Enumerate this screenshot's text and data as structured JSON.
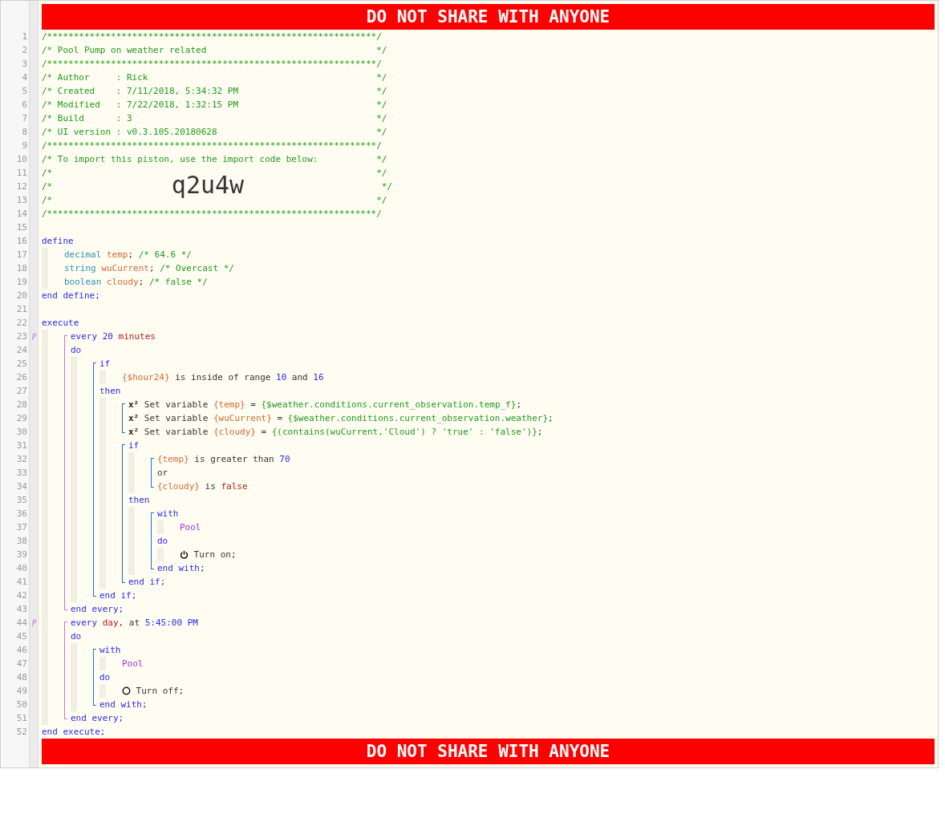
{
  "header_banner": "DO NOT SHARE WITH ANYONE",
  "code": [
    {
      "kind": "line",
      "number": "1",
      "marked": false,
      "tokens": [
        {
          "kind": "comment",
          "text": "/**************************************************************/"
        }
      ]
    },
    {
      "kind": "line",
      "number": "2",
      "marked": false,
      "tokens": [
        {
          "kind": "commentpad",
          "text": "/* Pool Pump on weather related"
        },
        {
          "kind": "comment",
          "text": "*/"
        }
      ]
    },
    {
      "kind": "line",
      "number": "3",
      "marked": false,
      "tokens": [
        {
          "kind": "comment",
          "text": "/**************************************************************/"
        }
      ]
    },
    {
      "kind": "line",
      "number": "4",
      "marked": false,
      "tokens": [
        {
          "kind": "commentpad",
          "text": "/* Author     : Rick"
        },
        {
          "kind": "comment",
          "text": "*/"
        }
      ]
    },
    {
      "kind": "line",
      "number": "5",
      "marked": false,
      "tokens": [
        {
          "kind": "commentpad",
          "text": "/* Created    : 7/11/2018, 5:34:32 PM"
        },
        {
          "kind": "comment",
          "text": "*/"
        }
      ]
    },
    {
      "kind": "line",
      "number": "6",
      "marked": false,
      "tokens": [
        {
          "kind": "commentpad",
          "text": "/* Modified   : 7/22/2018, 1:32:15 PM"
        },
        {
          "kind": "comment",
          "text": "*/"
        }
      ]
    },
    {
      "kind": "line",
      "number": "7",
      "marked": false,
      "tokens": [
        {
          "kind": "commentpad",
          "text": "/* Build      : 3"
        },
        {
          "kind": "comment",
          "text": "*/"
        }
      ]
    },
    {
      "kind": "line",
      "number": "8",
      "marked": false,
      "tokens": [
        {
          "kind": "commentpad",
          "text": "/* UI version : v0.3.105.20180628"
        },
        {
          "kind": "comment",
          "text": "*/"
        }
      ]
    },
    {
      "kind": "line",
      "number": "9",
      "marked": false,
      "tokens": [
        {
          "kind": "comment",
          "text": "/**************************************************************/"
        }
      ]
    },
    {
      "kind": "line",
      "number": "10",
      "marked": false,
      "tokens": [
        {
          "kind": "commentpad",
          "text": "/* To import this piston, use the import code below:"
        },
        {
          "kind": "comment",
          "text": "*/"
        }
      ]
    },
    {
      "kind": "line",
      "number": "11",
      "marked": false,
      "tokens": [
        {
          "kind": "commentpad",
          "text": "/*"
        },
        {
          "kind": "comment",
          "text": "*/"
        }
      ]
    },
    {
      "kind": "line",
      "number": "12",
      "marked": false,
      "tokens": [
        {
          "kind": "comment",
          "text": "/*"
        },
        {
          "kind": "code",
          "text": "q2u4w"
        },
        {
          "kind": "comment",
          "text": "*/"
        }
      ]
    },
    {
      "kind": "line",
      "number": "13",
      "marked": false,
      "tokens": [
        {
          "kind": "commentpad",
          "text": "/*"
        },
        {
          "kind": "comment",
          "text": "*/"
        }
      ]
    },
    {
      "kind": "line",
      "number": "14",
      "marked": false,
      "tokens": [
        {
          "kind": "comment",
          "text": "/**************************************************************/"
        }
      ]
    },
    {
      "kind": "line",
      "number": "15",
      "marked": false
    },
    {
      "kind": "line",
      "number": "16",
      "marked": false,
      "tokens": [
        {
          "kind": "keyword",
          "text": "define"
        }
      ]
    },
    {
      "kind": "body",
      "children": [
        {
          "kind": "line",
          "number": "17",
          "marked": false,
          "tokens": [
            {
              "kind": "type",
              "text": "decimal"
            },
            {
              "kind": "variable",
              "text": "temp"
            },
            {
              "kind": "glued",
              "text": ";"
            },
            {
              "kind": "comment",
              "text": "/* 64.6 */"
            }
          ]
        },
        {
          "kind": "line",
          "number": "18",
          "marked": false,
          "tokens": [
            {
              "kind": "type",
              "text": "string"
            },
            {
              "kind": "variable",
              "text": "wuCurrent"
            },
            {
              "kind": "glued",
              "text": ";"
            },
            {
              "kind": "comment",
              "text": "/* Overcast */"
            }
          ]
        },
        {
          "kind": "line",
          "number": "19",
          "marked": false,
          "tokens": [
            {
              "kind": "type",
              "text": "boolean"
            },
            {
              "kind": "variable",
              "text": "cloudy"
            },
            {
              "kind": "glued",
              "text": ";"
            },
            {
              "kind": "comment",
              "text": "/* false */"
            }
          ]
        }
      ]
    },
    {
      "kind": "line",
      "number": "20",
      "marked": false,
      "tokens": [
        {
          "kind": "keyword",
          "text": "end define;"
        }
      ]
    },
    {
      "kind": "line",
      "number": "21",
      "marked": false
    },
    {
      "kind": "line",
      "number": "22",
      "marked": false,
      "tokens": [
        {
          "kind": "keyword",
          "text": "execute"
        }
      ]
    },
    {
      "kind": "body",
      "children": [
        {
          "kind": "group",
          "color": "#d070d8",
          "children": [
            {
              "kind": "line",
              "number": "23",
              "marked": true,
              "tokens": [
                {
                  "kind": "keyword",
                  "text": "every"
                },
                {
                  "kind": "number",
                  "text": "20"
                },
                {
                  "kind": "unit",
                  "text": "minutes"
                }
              ]
            },
            {
              "kind": "line",
              "number": "24",
              "marked": false,
              "tokens": [
                {
                  "kind": "keyword",
                  "text": "do"
                }
              ]
            },
            {
              "kind": "body",
              "children": [
                {
                  "kind": "group",
                  "color": "#1a6fd8",
                  "children": [
                    {
                      "kind": "line",
                      "number": "25",
                      "marked": false,
                      "tokens": [
                        {
                          "kind": "keyword",
                          "text": "if"
                        }
                      ]
                    },
                    {
                      "kind": "body",
                      "children": [
                        {
                          "kind": "line",
                          "number": "26",
                          "marked": false,
                          "tokens": [
                            {
                              "kind": "variable",
                              "text": "{$hour24}"
                            },
                            {
                              "kind": "text",
                              "text": "is inside of range"
                            },
                            {
                              "kind": "number",
                              "text": "10"
                            },
                            {
                              "kind": "text",
                              "text": "and"
                            },
                            {
                              "kind": "number",
                              "text": "16"
                            }
                          ]
                        }
                      ]
                    },
                    {
                      "kind": "line",
                      "number": "27",
                      "marked": false,
                      "tokens": [
                        {
                          "kind": "keyword",
                          "text": "then"
                        }
                      ]
                    },
                    {
                      "kind": "body",
                      "children": [
                        {
                          "kind": "group",
                          "color": "#1a6fd8",
                          "children": [
                            {
                              "kind": "line",
                              "number": "28",
                              "marked": false,
                              "tokens": [
                                {
                                  "kind": "op",
                                  "text": "x²"
                                },
                                {
                                  "kind": "text",
                                  "text": "Set variable"
                                },
                                {
                                  "kind": "variable",
                                  "text": "{temp}"
                                },
                                {
                                  "kind": "text",
                                  "text": "="
                                },
                                {
                                  "kind": "expression",
                                  "text": "{$weather.conditions.current_observation.temp_f}"
                                },
                                {
                                  "kind": "glued",
                                  "text": ";"
                                }
                              ]
                            },
                            {
                              "kind": "line",
                              "number": "29",
                              "marked": false,
                              "tokens": [
                                {
                                  "kind": "op",
                                  "text": "x²"
                                },
                                {
                                  "kind": "text",
                                  "text": "Set variable"
                                },
                                {
                                  "kind": "variable",
                                  "text": "{wuCurrent}"
                                },
                                {
                                  "kind": "text",
                                  "text": "="
                                },
                                {
                                  "kind": "expression",
                                  "text": "{$weather.conditions.current_observation.weather}"
                                },
                                {
                                  "kind": "glued",
                                  "text": ";"
                                }
                              ]
                            },
                            {
                              "kind": "line",
                              "number": "30",
                              "marked": false,
                              "tokens": [
                                {
                                  "kind": "op",
                                  "text": "x²"
                                },
                                {
                                  "kind": "text",
                                  "text": "Set variable"
                                },
                                {
                                  "kind": "variable",
                                  "text": "{cloudy}"
                                },
                                {
                                  "kind": "text",
                                  "text": "="
                                },
                                {
                                  "kind": "expression",
                                  "text": "{(contains(wuCurrent,'Cloud') ? 'true' : 'false')}"
                                },
                                {
                                  "kind": "glued",
                                  "text": ";"
                                }
                              ]
                            }
                          ]
                        },
                        {
                          "kind": "group",
                          "color": "#1a6fd8",
                          "children": [
                            {
                              "kind": "line",
                              "number": "31",
                              "marked": false,
                              "tokens": [
                                {
                                  "kind": "keyword",
                                  "text": "if"
                                }
                              ]
                            },
                            {
                              "kind": "body",
                              "children": [
                                {
                                  "kind": "group",
                                  "color": "#1a6fd8",
                                  "children": [
                                    {
                                      "kind": "line",
                                      "number": "32",
                                      "marked": false,
                                      "tokens": [
                                        {
                                          "kind": "variable",
                                          "text": "{temp}"
                                        },
                                        {
                                          "kind": "text",
                                          "text": "is greater than"
                                        },
                                        {
                                          "kind": "number",
                                          "text": "70"
                                        }
                                      ]
                                    },
                                    {
                                      "kind": "line",
                                      "number": "33",
                                      "marked": false,
                                      "tokens": [
                                        {
                                          "kind": "text",
                                          "text": "or"
                                        }
                                      ]
                                    },
                                    {
                                      "kind": "line",
                                      "number": "34",
                                      "marked": false,
                                      "tokens": [
                                        {
                                          "kind": "variable",
                                          "text": "{cloudy}"
                                        },
                                        {
                                          "kind": "text",
                                          "text": "is"
                                        },
                                        {
                                          "kind": "unit",
                                          "text": "false"
                                        }
                                      ]
                                    }
                                  ]
                                }
                              ]
                            },
                            {
                              "kind": "line",
                              "number": "35",
                              "marked": false,
                              "tokens": [
                                {
                                  "kind": "keyword",
                                  "text": "then"
                                }
                              ]
                            },
                            {
                              "kind": "body",
                              "children": [
                                {
                                  "kind": "group",
                                  "color": "#1a6fd8",
                                  "children": [
                                    {
                                      "kind": "line",
                                      "number": "36",
                                      "marked": false,
                                      "tokens": [
                                        {
                                          "kind": "keyword",
                                          "text": "with"
                                        }
                                      ]
                                    },
                                    {
                                      "kind": "body",
                                      "children": [
                                        {
                                          "kind": "line",
                                          "number": "37",
                                          "marked": false,
                                          "tokens": [
                                            {
                                              "kind": "device",
                                              "text": "Pool"
                                            }
                                          ]
                                        }
                                      ]
                                    },
                                    {
                                      "kind": "line",
                                      "number": "38",
                                      "marked": false,
                                      "tokens": [
                                        {
                                          "kind": "keyword",
                                          "text": "do"
                                        }
                                      ]
                                    },
                                    {
                                      "kind": "body",
                                      "children": [
                                        {
                                          "kind": "line",
                                          "number": "39",
                                          "marked": false,
                                          "tokens": [
                                            {
                                              "kind": "switch",
                                              "on": true
                                            },
                                            {
                                              "kind": "text",
                                              "text": "Turn on;"
                                            }
                                          ]
                                        }
                                      ]
                                    },
                                    {
                                      "kind": "line",
                                      "number": "40",
                                      "marked": false,
                                      "tokens": [
                                        {
                                          "kind": "keyword",
                                          "text": "end with;"
                                        }
                                      ]
                                    }
                                  ]
                                }
                              ]
                            },
                            {
                              "kind": "line",
                              "number": "41",
                              "marked": false,
                              "tokens": [
                                {
                                  "kind": "keyword",
                                  "text": "end if;"
                                }
                              ]
                            }
                          ]
                        }
                      ]
                    },
                    {
                      "kind": "line",
                      "number": "42",
                      "marked": false,
                      "tokens": [
                        {
                          "kind": "keyword",
                          "text": "end if;"
                        }
                      ]
                    }
                  ]
                }
              ]
            },
            {
              "kind": "line",
              "number": "43",
              "marked": false,
              "tokens": [
                {
                  "kind": "keyword",
                  "text": "end every;"
                }
              ]
            }
          ]
        },
        {
          "kind": "group",
          "color": "#d070d8",
          "children": [
            {
              "kind": "line",
              "number": "44",
              "marked": true,
              "tokens": [
                {
                  "kind": "keyword",
                  "text": "every"
                },
                {
                  "kind": "unit",
                  "text": "day,"
                },
                {
                  "kind": "text",
                  "text": "at"
                },
                {
                  "kind": "number",
                  "text": "5:45:00 PM"
                }
              ]
            },
            {
              "kind": "line",
              "number": "45",
              "marked": false,
              "tokens": [
                {
                  "kind": "keyword",
                  "text": "do"
                }
              ]
            },
            {
              "kind": "body",
              "children": [
                {
                  "kind": "group",
                  "color": "#1a6fd8",
                  "children": [
                    {
                      "kind": "line",
                      "number": "46",
                      "marked": false,
                      "tokens": [
                        {
                          "kind": "keyword",
                          "text": "with"
                        }
                      ]
                    },
                    {
                      "kind": "body",
                      "children": [
                        {
                          "kind": "line",
                          "number": "47",
                          "marked": false,
                          "tokens": [
                            {
                              "kind": "device",
                              "text": "Pool"
                            }
                          ]
                        }
                      ]
                    },
                    {
                      "kind": "line",
                      "number": "48",
                      "marked": false,
                      "tokens": [
                        {
                          "kind": "keyword",
                          "text": "do"
                        }
                      ]
                    },
                    {
                      "kind": "body",
                      "children": [
                        {
                          "kind": "line",
                          "number": "49",
                          "marked": false,
                          "tokens": [
                            {
                              "kind": "switch",
                              "on": false
                            },
                            {
                              "kind": "text",
                              "text": "Turn off;"
                            }
                          ]
                        }
                      ]
                    },
                    {
                      "kind": "line",
                      "number": "50",
                      "marked": false,
                      "tokens": [
                        {
                          "kind": "keyword",
                          "text": "end with;"
                        }
                      ]
                    }
                  ]
                }
              ]
            },
            {
              "kind": "line",
              "number": "51",
              "marked": false,
              "tokens": [
                {
                  "kind": "keyword",
                  "text": "end every;"
                }
              ]
            }
          ]
        }
      ]
    },
    {
      "kind": "line",
      "number": "52",
      "marked": false,
      "tokens": [
        {
          "kind": "keyword",
          "text": "end execute;"
        }
      ]
    }
  ],
  "footer_banner": "DO NOT SHARE WITH ANYONE"
}
